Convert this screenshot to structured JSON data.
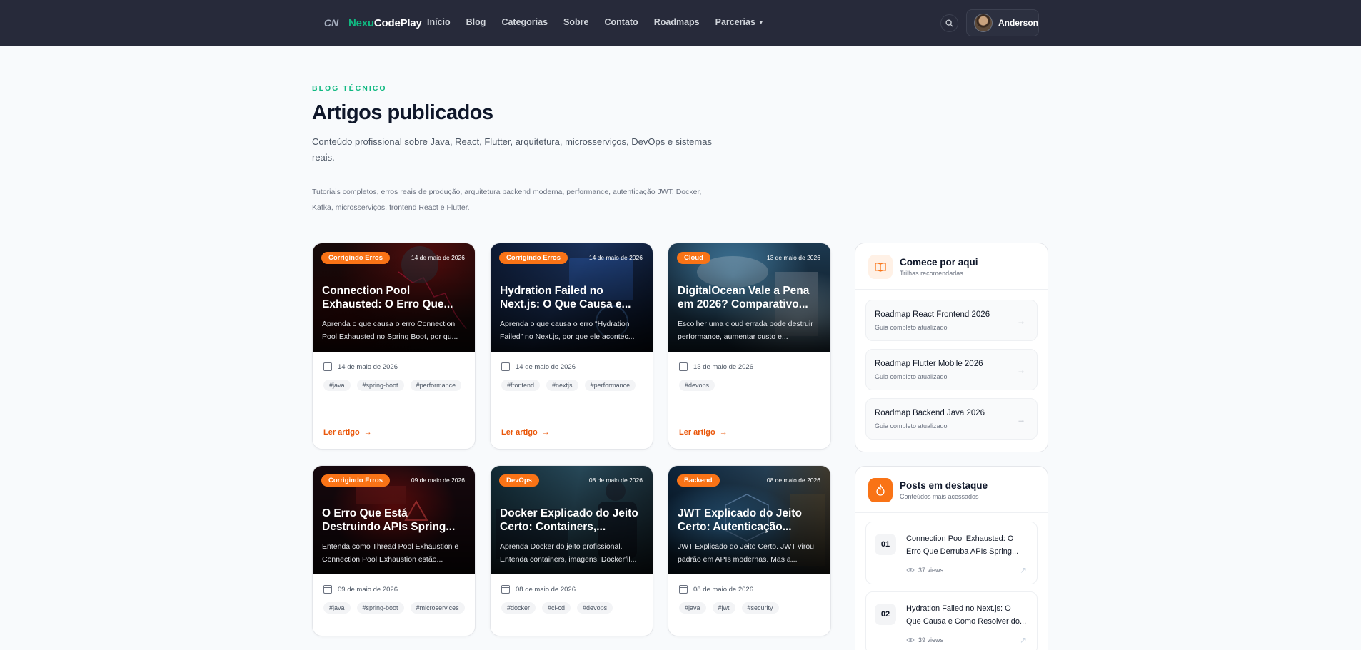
{
  "header": {
    "brand_mark": "CN",
    "brand_part1": "Nexu",
    "brand_part2": "CodePlay",
    "nav": [
      "Início",
      "Blog",
      "Categorias",
      "Sobre",
      "Contato",
      "Roadmaps",
      "Parcerias"
    ],
    "user_name": "Anderson"
  },
  "hero": {
    "kicker": "BLOG TÉCNICO",
    "title": "Artigos publicados",
    "lead": "Conteúdo profissional sobre Java, React, Flutter, arquitetura, microsserviços, DevOps e sistemas reais.",
    "sub": "Tutoriais completos, erros reais de produção, arquitetura backend moderna, performance, autenticação JWT, Docker, Kafka, microsserviços, frontend React e Flutter."
  },
  "cards": [
    {
      "category": "Corrigindo Erros",
      "date": "14 de maio de 2026",
      "title1": "Connection Pool",
      "title2": "Exhausted: O Erro Que...",
      "excerpt1": "Aprenda o que causa o erro Connection",
      "excerpt2": "Pool Exhausted no Spring Boot, por qu...",
      "meta_date": "14 de maio de 2026",
      "tags": [
        "#java",
        "#spring-boot",
        "#performance"
      ],
      "cta": "Ler artigo"
    },
    {
      "category": "Corrigindo Erros",
      "date": "14 de maio de 2026",
      "title1": "Hydration Failed no",
      "title2": "Next.js: O Que Causa e...",
      "excerpt1": "Aprenda o que causa o erro “Hydration",
      "excerpt2": "Failed” no Next.js, por que ele acontec...",
      "meta_date": "14 de maio de 2026",
      "tags": [
        "#frontend",
        "#nextjs",
        "#performance"
      ],
      "cta": "Ler artigo"
    },
    {
      "category": "Cloud",
      "date": "13 de maio de 2026",
      "title1": "DigitalOcean Vale a Pena",
      "title2": "em 2026? Comparativo...",
      "excerpt1": "Escolher uma cloud errada pode destruir",
      "excerpt2": "performance, aumentar custo e...",
      "meta_date": "13 de maio de 2026",
      "tags": [
        "#devops"
      ],
      "cta": "Ler artigo"
    },
    {
      "category": "Corrigindo Erros",
      "date": "09 de maio de 2026",
      "title1": "O Erro Que Está",
      "title2": "Destruindo APIs Spring...",
      "excerpt1": "Entenda como Thread Pool Exhaustion e",
      "excerpt2": "Connection Pool Exhaustion estão...",
      "meta_date": "09 de maio de 2026",
      "tags": [
        "#java",
        "#spring-boot",
        "#microservices"
      ],
      "cta": "Ler artigo"
    },
    {
      "category": "DevOps",
      "date": "08 de maio de 2026",
      "title1": "Docker Explicado do Jeito",
      "title2": "Certo: Containers,...",
      "excerpt1": "Aprenda Docker do jeito profissional.",
      "excerpt2": "Entenda containers, imagens, Dockerfil...",
      "meta_date": "08 de maio de 2026",
      "tags": [
        "#docker",
        "#ci-cd",
        "#devops"
      ],
      "cta": "Ler artigo"
    },
    {
      "category": "Backend",
      "date": "08 de maio de 2026",
      "title1": "JWT Explicado do Jeito",
      "title2": "Certo: Autenticação...",
      "excerpt1": "JWT Explicado do Jeito Certo. JWT virou",
      "excerpt2": "padrão em APIs modernas. Mas a...",
      "meta_date": "08 de maio de 2026",
      "tags": [
        "#java",
        "#jwt",
        "#security"
      ],
      "cta": "Ler artigo"
    }
  ],
  "sidebar": {
    "start": {
      "title": "Comece por aqui",
      "subtitle": "Trilhas recomendadas",
      "items": [
        {
          "title": "Roadmap React Frontend 2026",
          "sub": "Guia completo atualizado"
        },
        {
          "title": "Roadmap Flutter Mobile 2026",
          "sub": "Guia completo atualizado"
        },
        {
          "title": "Roadmap Backend Java 2026",
          "sub": "Guia completo atualizado"
        }
      ]
    },
    "featured": {
      "title": "Posts em destaque",
      "subtitle": "Conteúdos mais acessados",
      "items": [
        {
          "rank": "01",
          "line1": "Connection Pool Exhausted: O",
          "line2": "Erro Que Derruba APIs Spring...",
          "views": "37 views"
        },
        {
          "rank": "02",
          "line1": "Hydration Failed no Next.js: O",
          "line2": "Que Causa e Como Resolver do...",
          "views": "39 views"
        }
      ]
    }
  },
  "colors": {
    "accent": "#f97316",
    "brand_green": "#10b981",
    "header_bg": "#272a3a"
  }
}
